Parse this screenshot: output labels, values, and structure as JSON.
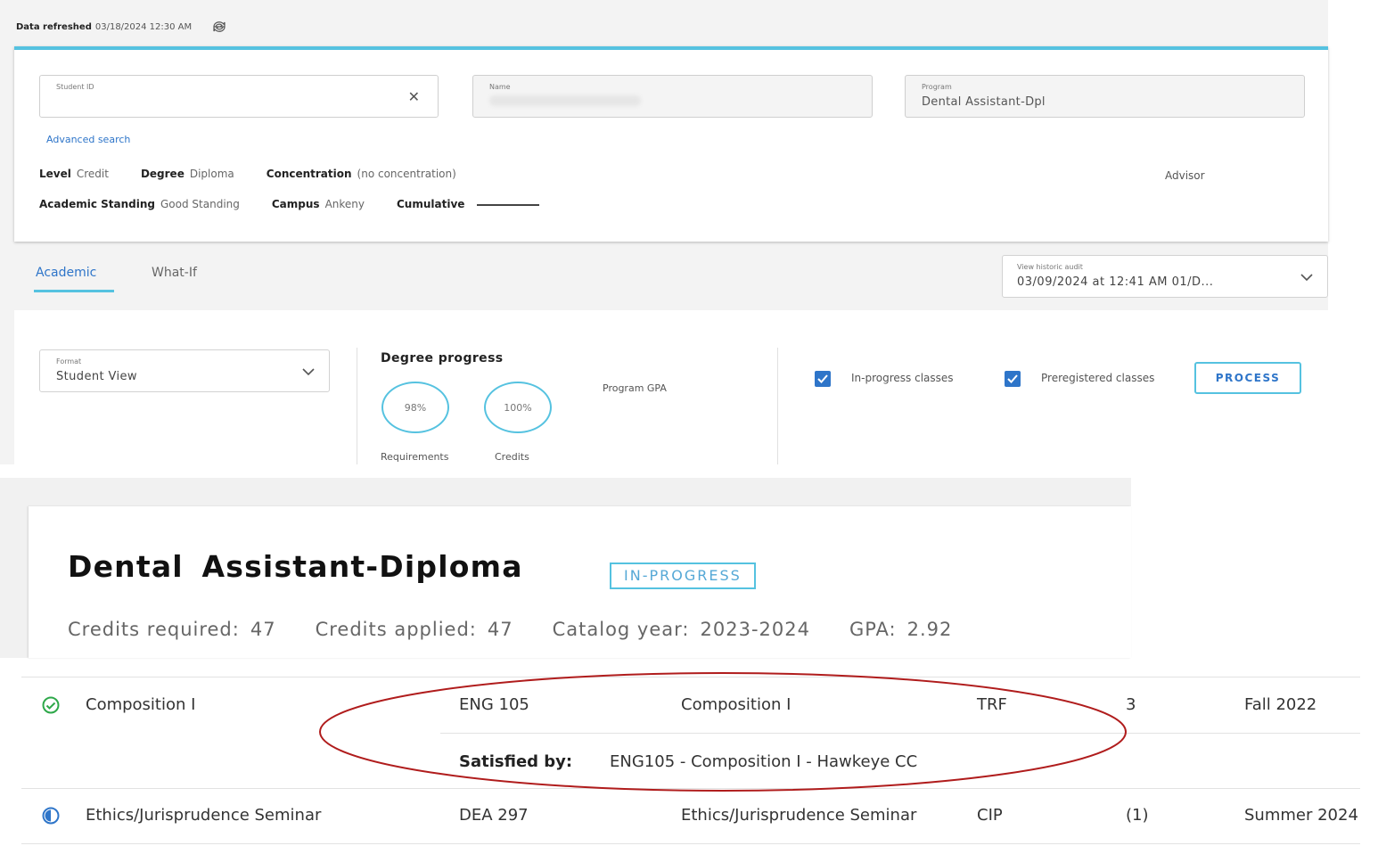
{
  "refresh": {
    "label": "Data refreshed",
    "timestamp": "03/18/2024 12:30 AM",
    "icon": "refresh-icon"
  },
  "student": {
    "id_label": "Student ID",
    "id_value": "",
    "name_label": "Name",
    "program_label": "Program",
    "program_value": "Dental Assistant-Dpl",
    "advanced_search": "Advanced search",
    "level_label": "Level",
    "level_value": "Credit",
    "degree_label": "Degree",
    "degree_value": "Diploma",
    "concentration_label": "Concentration",
    "concentration_value": "(no concentration)",
    "advisor_label": "Advisor",
    "standing_label": "Academic Standing",
    "standing_value": "Good Standing",
    "campus_label": "Campus",
    "campus_value": "Ankeny",
    "cumulative_label": "Cumulative"
  },
  "tabs": [
    {
      "label": "Academic"
    },
    {
      "label": "What-If"
    }
  ],
  "historic": {
    "label": "View historic audit",
    "value": "03/09/2024 at 12:41 AM 01/D..."
  },
  "format": {
    "label": "Format",
    "value": "Student View"
  },
  "progress": {
    "title": "Degree progress",
    "requirements_pct": "98%",
    "credits_pct": "100%",
    "requirements_label": "Requirements",
    "credits_label": "Credits",
    "gpa_label": "Program GPA"
  },
  "options": {
    "inprogress_label": "In-progress classes",
    "preregistered_label": "Preregistered classes",
    "process_label": "PROCESS"
  },
  "program": {
    "title": "Dental Assistant-Diploma",
    "status": "IN-PROGRESS",
    "credits_required_label": "Credits required:",
    "credits_required": "47",
    "credits_applied_label": "Credits applied:",
    "credits_applied": "47",
    "catalog_label": "Catalog year:",
    "catalog_year": "2023-2024",
    "gpa_label": "GPA:",
    "gpa": "2.92"
  },
  "courses": [
    {
      "status_icon": "check-circle-icon",
      "requirement": "Composition I",
      "course": "ENG 105",
      "title": "Composition I",
      "grade": "TRF",
      "credits": "3",
      "term": "Fall 2022",
      "satisfied_label": "Satisfied by:",
      "satisfied_value": "ENG105 - Composition I - Hawkeye CC"
    },
    {
      "status_icon": "half-circle-icon",
      "requirement": "Ethics/Jurisprudence Seminar",
      "course": "DEA 297",
      "title": "Ethics/Jurisprudence Seminar",
      "grade": "CIP",
      "credits": "(1)",
      "term": "Summer 2024"
    }
  ],
  "colors": {
    "accent": "#55c2e0",
    "link": "#2e75c9",
    "complete": "#2ea84a",
    "annotation": "#b01c1c"
  }
}
